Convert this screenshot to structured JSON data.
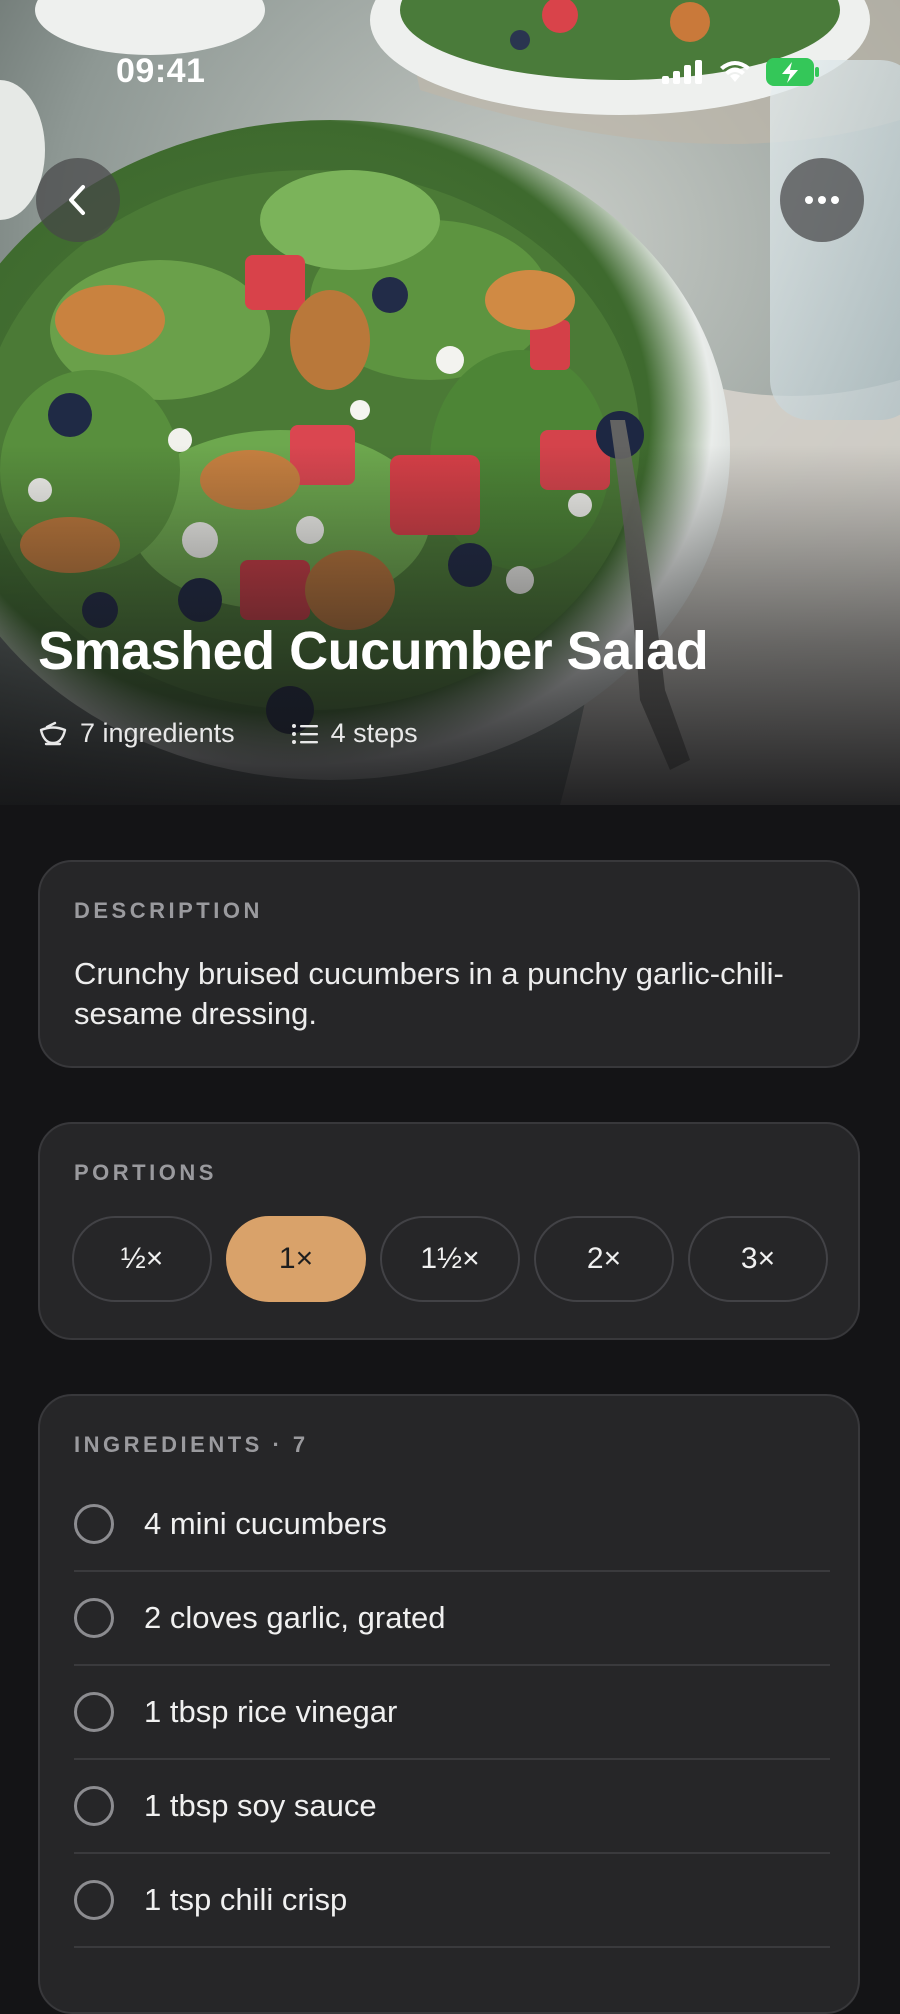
{
  "status_bar": {
    "time": "09:41"
  },
  "hero": {
    "title": "Smashed Cucumber Salad",
    "ingredients_meta": "7 ingredients",
    "steps_meta": "4 steps"
  },
  "icons": {
    "back": "chevron-left-icon",
    "more": "ellipsis-icon",
    "ingredients": "bowl-icon",
    "steps": "list-icon"
  },
  "description": {
    "label": "DESCRIPTION",
    "text": "Crunchy bruised cucumbers in a punchy garlic-chili-sesame dressing."
  },
  "portions": {
    "label": "PORTIONS",
    "options": [
      "½×",
      "1×",
      "1½×",
      "2×",
      "3×"
    ],
    "selected": "1×",
    "accent_color": "#d9a26a"
  },
  "ingredients": {
    "label": "INGREDIENTS · 7",
    "items": [
      "4 mini cucumbers",
      "2 cloves garlic, grated",
      "1 tbsp rice vinegar",
      "1 tbsp soy sauce",
      "1 tsp chili crisp"
    ]
  }
}
